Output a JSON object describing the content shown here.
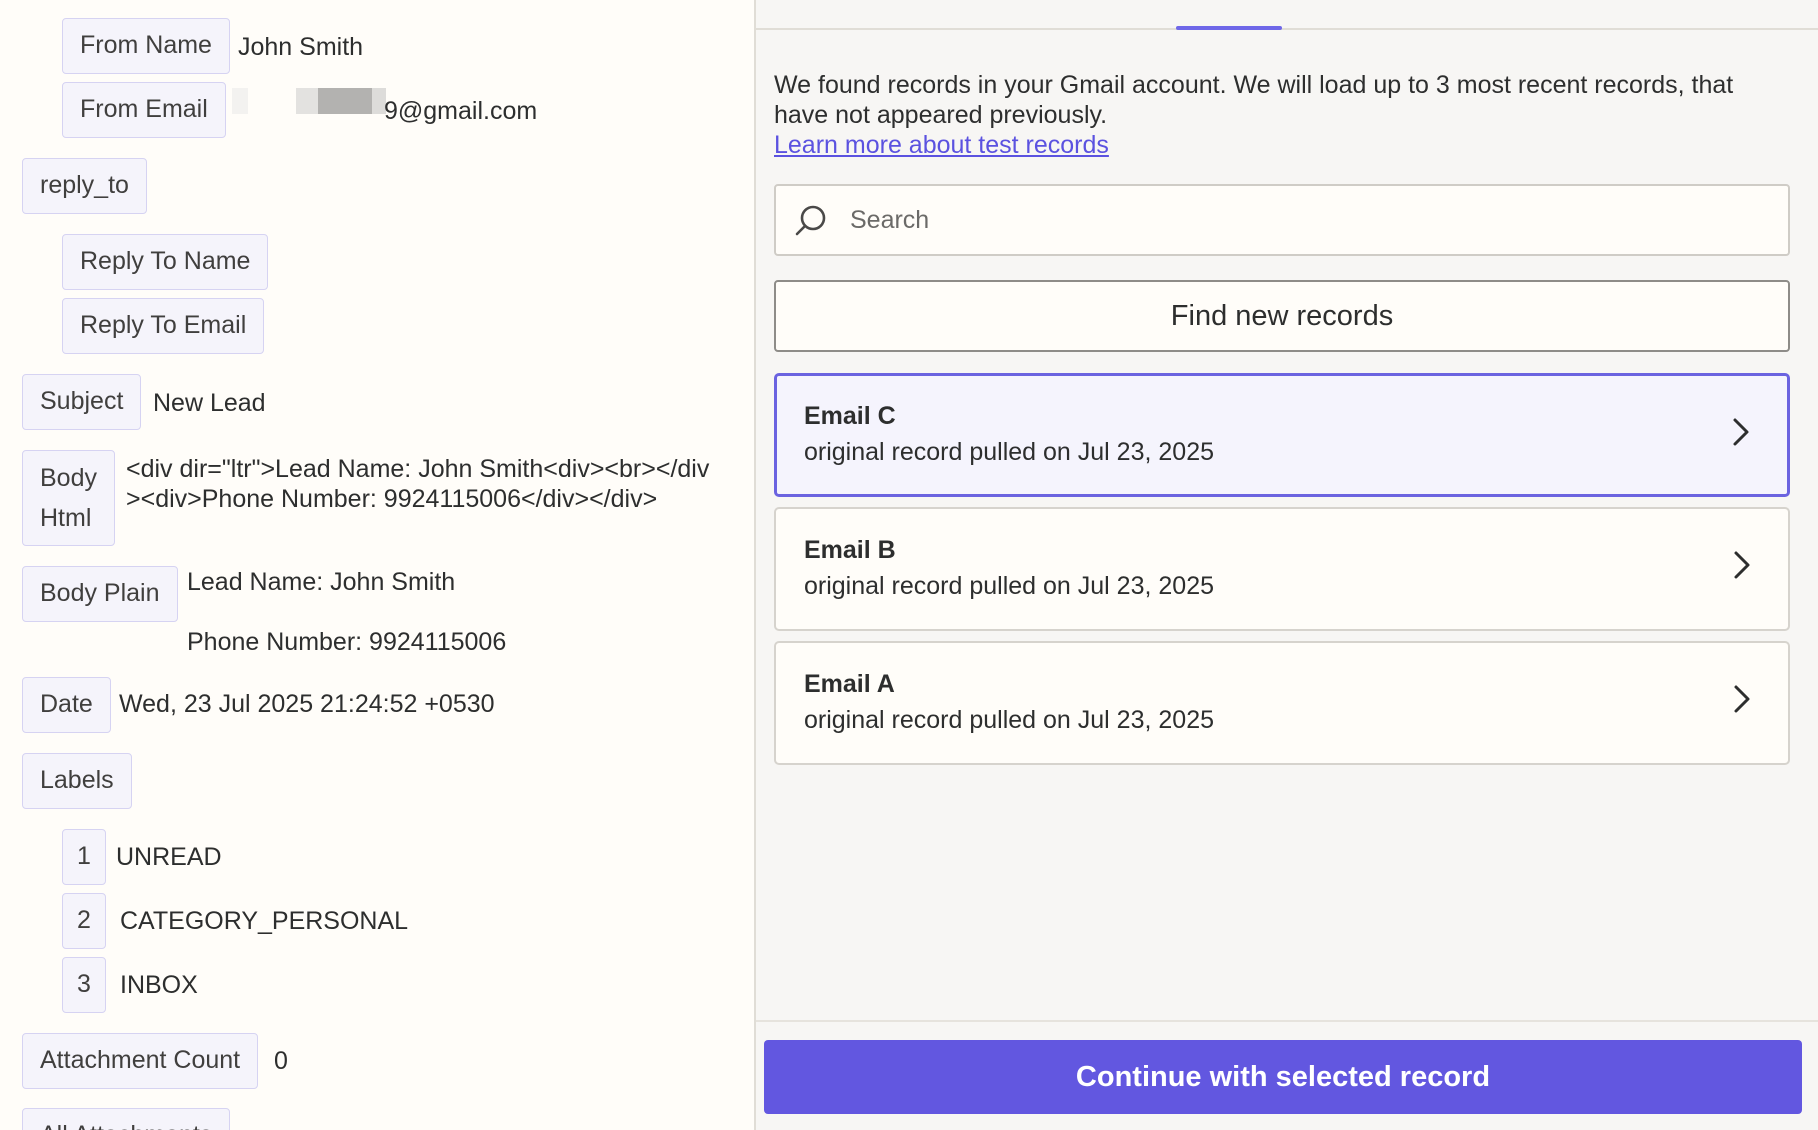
{
  "left": {
    "fields": {
      "from_name": {
        "label": "From Name",
        "value": "John Smith"
      },
      "from_email": {
        "label": "From Email",
        "value": "9@gmail.com"
      },
      "reply_to": {
        "label": "reply_to"
      },
      "reply_to_name": {
        "label": "Reply To Name"
      },
      "reply_to_email": {
        "label": "Reply To Email"
      },
      "subject": {
        "label": "Subject",
        "value": "New Lead"
      },
      "body_html": {
        "label_line1": "Body",
        "label_line2": "Html",
        "value": "<div dir=\"ltr\">Lead Name: John Smith<div><br></div><div>Phone Number: 9924115006</div></div>"
      },
      "body_plain": {
        "label": "Body Plain",
        "value_line1": "Lead Name: John Smith",
        "value_line2": "Phone Number: 9924115006"
      },
      "date": {
        "label": "Date",
        "value": "Wed, 23 Jul 2025 21:24:52 +0530"
      },
      "labels": {
        "label": "Labels"
      },
      "attachment_count": {
        "label": "Attachment Count",
        "value": "0"
      },
      "all_attachments": {
        "label": "All Attachments"
      }
    },
    "label_items": [
      {
        "index": "1",
        "value": "UNREAD"
      },
      {
        "index": "2",
        "value": "CATEGORY_PERSONAL"
      },
      {
        "index": "3",
        "value": "INBOX"
      }
    ]
  },
  "right": {
    "intro_text": "We found records in your Gmail account. We will load up to 3 most recent records, that have not appeared previously.",
    "learn_more_link": "Learn more about test records",
    "search_placeholder": "Search",
    "find_button": "Find new records",
    "records": [
      {
        "title": "Email C",
        "subtitle": "original record pulled on Jul 23, 2025",
        "selected": true
      },
      {
        "title": "Email B",
        "subtitle": "original record pulled on Jul 23, 2025",
        "selected": false
      },
      {
        "title": "Email A",
        "subtitle": "original record pulled on Jul 23, 2025",
        "selected": false
      }
    ],
    "continue_button": "Continue with selected record"
  },
  "colors": {
    "accent": "#6257e0",
    "selected_border": "#6b63e0",
    "tag_bg": "#f5f4fb",
    "tag_border": "#d6d3f2",
    "link": "#5b52e0"
  },
  "icons": {
    "search": "search-icon",
    "chevron": "chevron-right-icon"
  }
}
